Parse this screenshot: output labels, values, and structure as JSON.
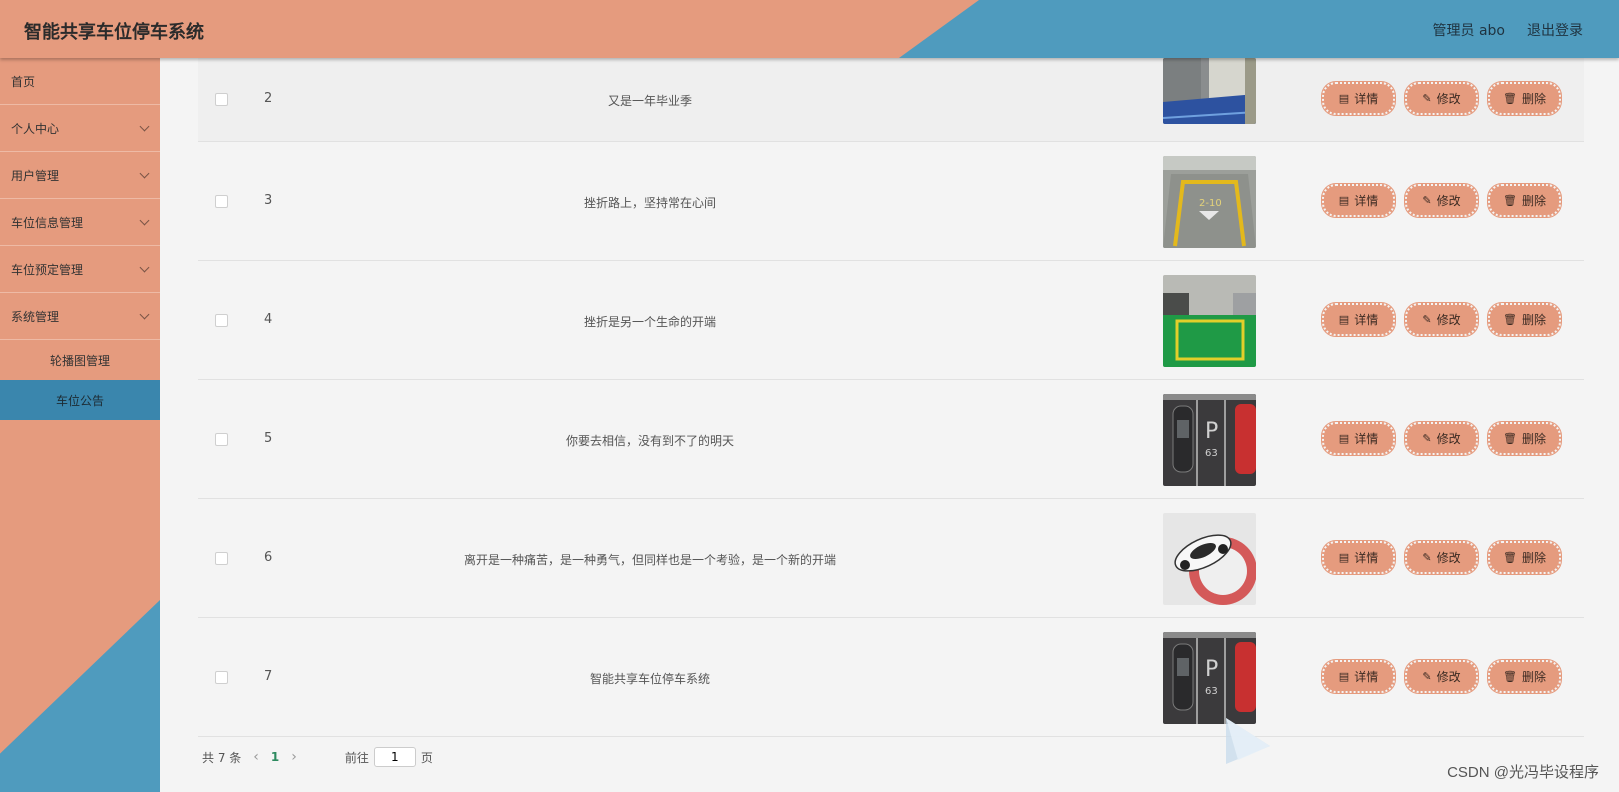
{
  "header": {
    "title": "智能共享车位停车系统",
    "user": "管理员 abo",
    "logout": "退出登录"
  },
  "sidebar": {
    "items": [
      {
        "label": "首页",
        "chevron": false
      },
      {
        "label": "个人中心",
        "chevron": true
      },
      {
        "label": "用户管理",
        "chevron": true
      },
      {
        "label": "车位信息管理",
        "chevron": true
      },
      {
        "label": "车位预定管理",
        "chevron": true
      },
      {
        "label": "系统管理",
        "chevron": true
      }
    ],
    "subitems": [
      {
        "label": "轮播图管理",
        "active": false
      },
      {
        "label": "车位公告",
        "active": true
      }
    ]
  },
  "table": {
    "rows": [
      {
        "num": "2",
        "title": "又是一年毕业季",
        "img": "parking-blue"
      },
      {
        "num": "3",
        "title": "挫折路上，坚持常在心间",
        "img": "parking-yellow"
      },
      {
        "num": "4",
        "title": "挫折是另一个生命的开端",
        "img": "parking-green"
      },
      {
        "num": "5",
        "title": "你要去相信，没有到不了的明天",
        "img": "parking-topview"
      },
      {
        "num": "6",
        "title": "离开是一种痛苦，是一种勇气，但同样也是一个考验，是一个新的开端",
        "img": "car-white"
      },
      {
        "num": "7",
        "title": "智能共享车位停车系统",
        "img": "parking-topview"
      }
    ],
    "actions": {
      "detail": "详情",
      "edit": "修改",
      "delete": "删除"
    }
  },
  "pagination": {
    "total": "共 7 条",
    "current": "1",
    "goto": "前往",
    "goto_value": "1",
    "page_unit": "页"
  },
  "watermark": "CSDN @光冯毕设程序",
  "colors": {
    "primary": "#e59b7e",
    "accent": "#4f9bbe",
    "active": "#3a86ad"
  }
}
